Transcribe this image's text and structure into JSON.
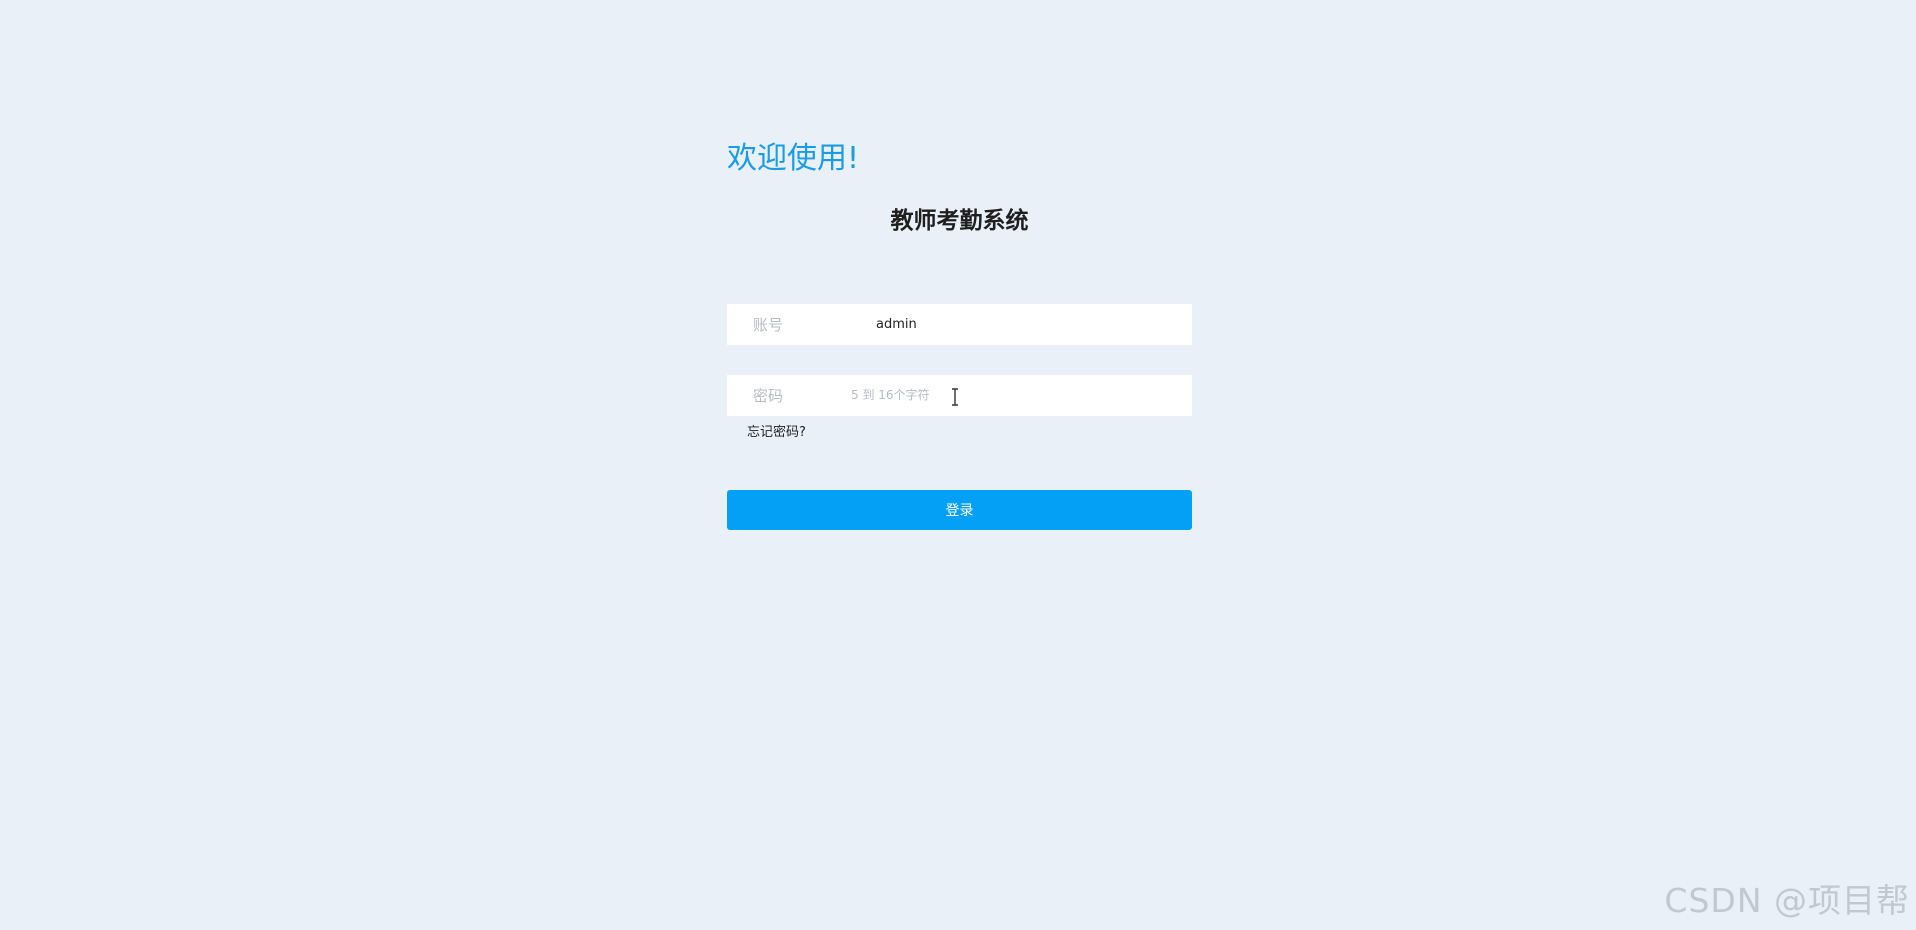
{
  "welcome": "欢迎使用!",
  "system_title": "教师考勤系统",
  "account": {
    "label": "账号",
    "value": "admin"
  },
  "password": {
    "label": "密码",
    "placeholder": "5 到 16个字符"
  },
  "forgot_password": "忘记密码?",
  "login_button": "登录",
  "watermark": "CSDN @项目帮",
  "colors": {
    "background": "#eaf0f7",
    "welcome_text": "#1a9be6",
    "button": "#04a0f5",
    "label_text": "#b7bcc3"
  },
  "icons": {
    "text_cursor": "i-beam-cursor-icon"
  }
}
